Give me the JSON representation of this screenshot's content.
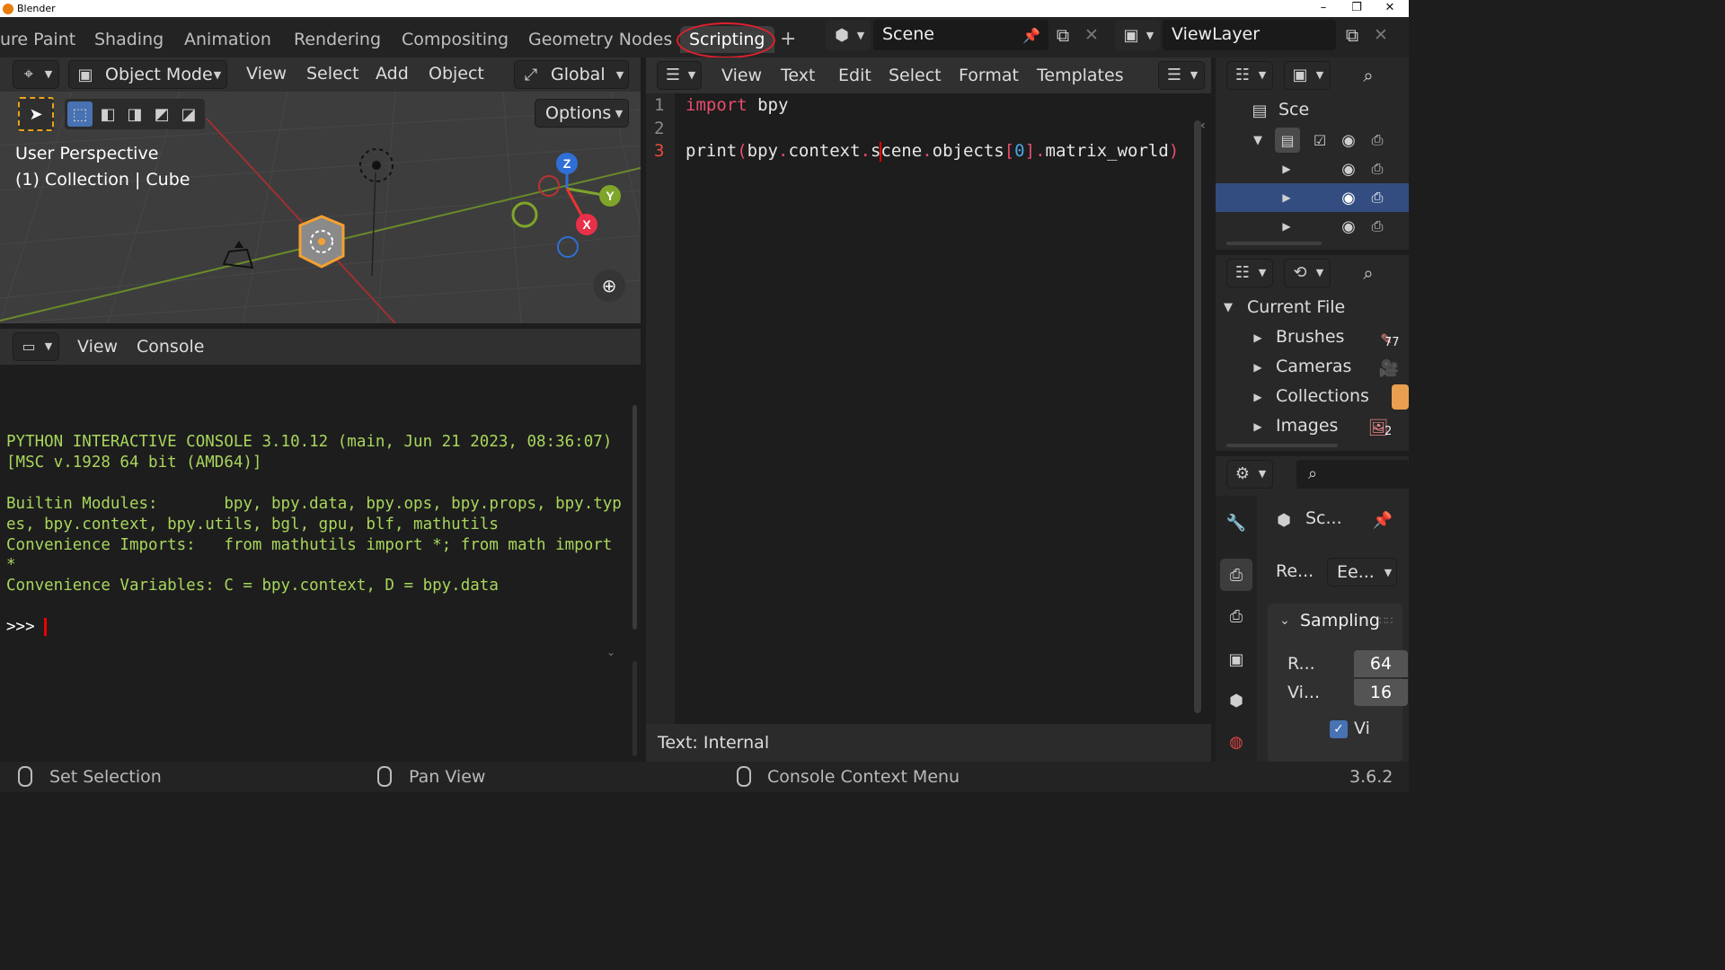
{
  "window": {
    "title": "Blender",
    "minimize": "–",
    "maximize": "❐",
    "close": "✕"
  },
  "workspace_tabs": [
    "ure Paint",
    "Shading",
    "Animation",
    "Rendering",
    "Compositing",
    "Geometry Nodes",
    "Scripting"
  ],
  "active_tab": "Scripting",
  "add_tab": "+",
  "scene": {
    "name": "Scene"
  },
  "view_layer": {
    "name": "ViewLayer"
  },
  "viewport": {
    "mode": "Object Mode",
    "menus": [
      "View",
      "Select",
      "Add",
      "Object"
    ],
    "transform": "Global",
    "options": "Options",
    "overlay_line1": "User Perspective",
    "overlay_line2": "(1) Collection | Cube",
    "gizmo": {
      "x": "X",
      "y": "Y",
      "z": "Z"
    }
  },
  "console": {
    "menus": [
      "View",
      "Console"
    ],
    "lines": [
      "PYTHON INTERACTIVE CONSOLE 3.10.12 (main, Jun 21 2023, 08:36:07)",
      "[MSC v.1928 64 bit (AMD64)]",
      "",
      "Builtin Modules:       bpy, bpy.data, bpy.ops, bpy.props, bpy.typ",
      "es, bpy.context, bpy.utils, bgl, gpu, blf, mathutils",
      "Convenience Imports:   from mathutils import *; from math import",
      "*",
      "Convenience Variables: C = bpy.context, D = bpy.data",
      "",
      ">>> "
    ]
  },
  "text_editor": {
    "menus": [
      "View",
      "Text",
      "Edit",
      "Select",
      "Format",
      "Templates"
    ],
    "line_numbers": [
      "1",
      "2",
      "3"
    ],
    "line1_kw": "import",
    "line1_rest": " bpy",
    "line3_a": "print",
    "line3_b": "(",
    "line3_c": "bpy",
    "line3_d": ".",
    "line3_e": "context",
    "line3_f": ".",
    "line3_g": "s",
    "line3_h": "cene",
    "line3_i": ".",
    "line3_j": "objects",
    "line3_k": "[",
    "line3_l": "0",
    "line3_m": "]",
    "line3_n": ".",
    "line3_o": "matrix_world",
    "line3_p": ")",
    "footer": "Text: Internal"
  },
  "outliner": {
    "root": "Sce"
  },
  "blend_file": {
    "root": "Current File",
    "items": [
      {
        "label": "Brushes",
        "badge": "77"
      },
      {
        "label": "Cameras",
        "badge": ""
      },
      {
        "label": "Collections",
        "badge": ""
      },
      {
        "label": "Images",
        "badge": "2"
      }
    ]
  },
  "properties": {
    "scene_label": "Sc...",
    "render_label": "Re...",
    "engine": "Ee...",
    "panel": "Sampling",
    "render_samples_label": "R...",
    "render_samples": "64",
    "viewport_samples_label": "Vi...",
    "viewport_samples": "16",
    "checkbox_label": "Vi"
  },
  "status": {
    "left": "Set Selection",
    "middle": "Pan View",
    "right": "Console Context Menu",
    "version": "3.6.2"
  },
  "colors": {
    "accent": "#334d80",
    "console_text": "#a8d65c",
    "keyword": "#e84c6c"
  }
}
